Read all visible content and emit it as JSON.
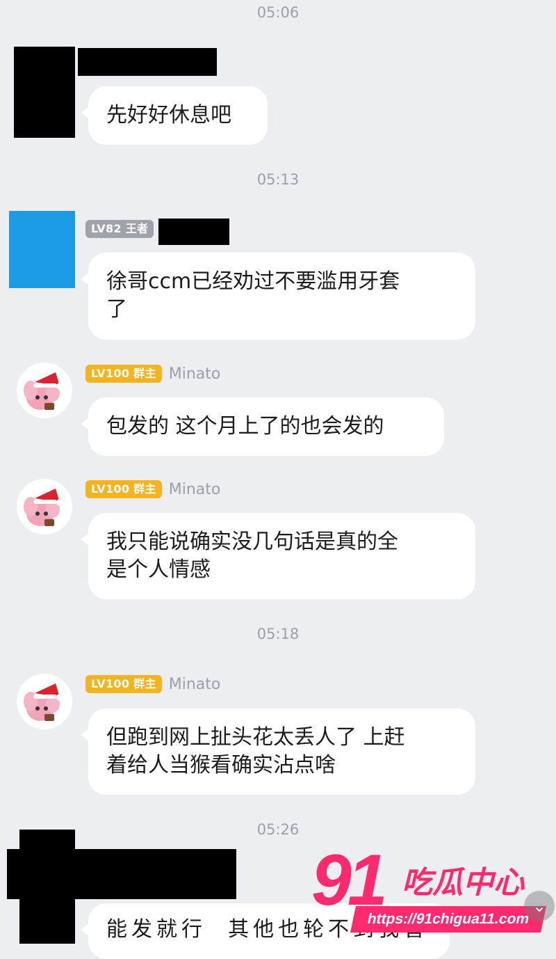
{
  "timestamps": [
    "05:06",
    "05:13",
    "05:18",
    "05:26"
  ],
  "messages": [
    {
      "text": "先好好休息吧"
    },
    {
      "badge": "LV82 王者",
      "text": "徐哥ccm已经劝过不要滥用牙套\n了"
    },
    {
      "badge": "LV100 群主",
      "name": "Minato",
      "text": "包发的 这个月上了的也会发的"
    },
    {
      "badge": "LV100 群主",
      "name": "Minato",
      "text": "我只能说确实没几句话是真的全\n是个人情感"
    },
    {
      "badge": "LV100 群主",
      "name": "Minato",
      "text": "但跑到网上扯头花太丢人了 上赶\n着给人当猴看确实沾点啥"
    },
    {
      "text": "能发就行  其他也轮不到我管"
    }
  ],
  "watermark": {
    "number": "91",
    "title": "吃瓜中心",
    "url": "https://91chigua11.com"
  },
  "icons": {
    "avatar": "anime-girl-santa-hat-avatar",
    "scroll": "chevron-down-icon"
  },
  "colors": {
    "background": "#eceef2",
    "badge_gold": "#f4b420",
    "badge_gray": "#9ea3aa",
    "watermark": "#ff2a6d"
  }
}
